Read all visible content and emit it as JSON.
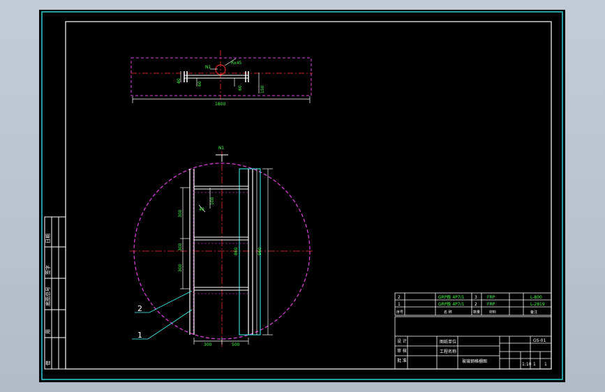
{
  "colors": {
    "frame": "#2fd2d2",
    "white": "#ffffff",
    "magenta": "#e040e0",
    "red": "#ff3030",
    "green": "#40ff40",
    "yellow": "#ffff40",
    "cyan": "#40ffff"
  },
  "plan_view": {
    "top_label": "N1",
    "angle_label": "Rx45",
    "dims": [
      "40",
      "60",
      "60",
      "150"
    ],
    "total_width": "1800"
  },
  "section_view": {
    "top_label": "N1",
    "dims_left": [
      "300",
      "300",
      "300"
    ],
    "dim_small": "100",
    "dim_angle": "40",
    "dim_inner": "860",
    "dim_total": "960",
    "bottom_dims": [
      "300",
      "500"
    ]
  },
  "leaders": [
    "2",
    "1"
  ],
  "parts_table": [
    {
      "no": "2",
      "name": "GRP板 4P7/1",
      "qty": "3",
      "mat": "FRP",
      "note": "L-800"
    },
    {
      "no": "1",
      "name": "GRP板 4P7/1",
      "qty": "2",
      "mat": "FRP",
      "note": "L-2819"
    }
  ],
  "parts_header": [
    "序号",
    "名 称",
    "数量",
    "材料",
    "备注"
  ],
  "title_block": {
    "labels": [
      "设 计",
      "审 核",
      "批 准"
    ],
    "company": "图纸单位",
    "project": "工程名称",
    "drawing": "玻璃钢格栅图",
    "drawing_no": "GS-01",
    "scale": "1:10",
    "sheet": "1",
    "sheets": "1"
  },
  "side_block": [
    "借",
    "用",
    "底图总号",
    "签字",
    "日期"
  ]
}
